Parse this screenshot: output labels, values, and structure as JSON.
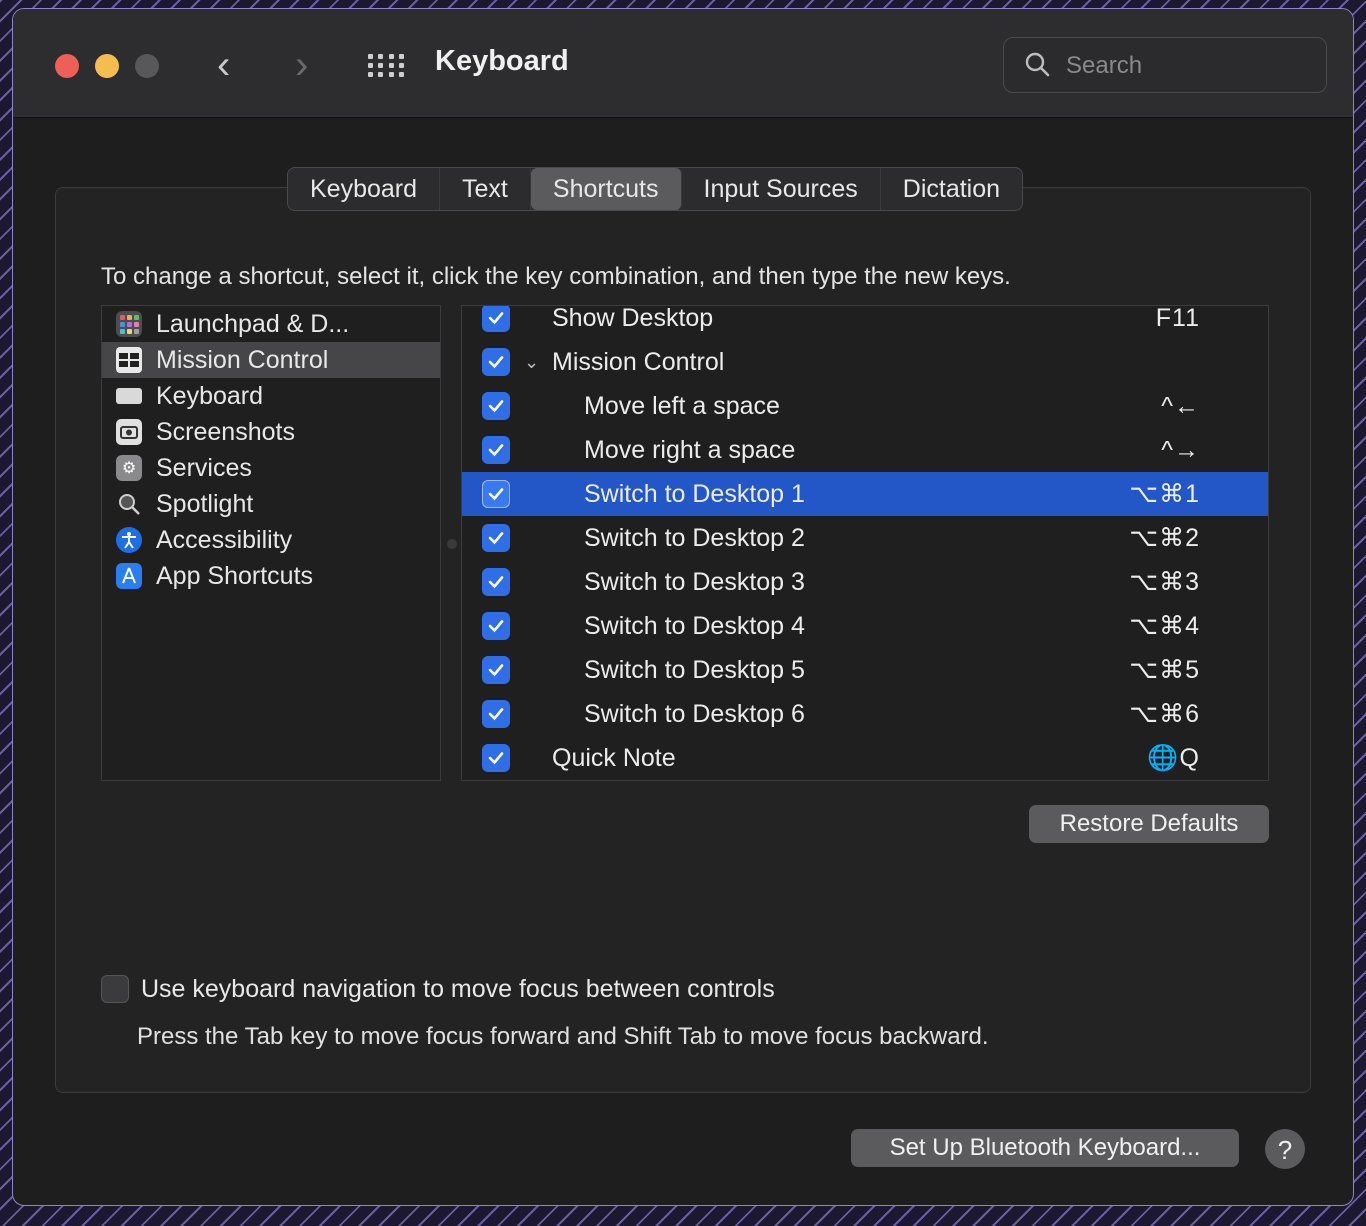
{
  "window": {
    "title": "Keyboard",
    "search_placeholder": "Search"
  },
  "tabs": [
    {
      "label": "Keyboard",
      "active": false
    },
    {
      "label": "Text",
      "active": false
    },
    {
      "label": "Shortcuts",
      "active": true
    },
    {
      "label": "Input Sources",
      "active": false
    },
    {
      "label": "Dictation",
      "active": false
    }
  ],
  "hint": "To change a shortcut, select it, click the key combination, and then type the new keys.",
  "categories": [
    {
      "label": "Launchpad & D...",
      "icon": "launchpad-icon",
      "selected": false
    },
    {
      "label": "Mission Control",
      "icon": "mission-control-icon",
      "selected": true
    },
    {
      "label": "Keyboard",
      "icon": "keyboard-icon",
      "selected": false
    },
    {
      "label": "Screenshots",
      "icon": "screenshots-icon",
      "selected": false
    },
    {
      "label": "Services",
      "icon": "services-gear-icon",
      "selected": false
    },
    {
      "label": "Spotlight",
      "icon": "spotlight-magnifier-icon",
      "selected": false
    },
    {
      "label": "Accessibility",
      "icon": "accessibility-icon",
      "selected": false
    },
    {
      "label": "App Shortcuts",
      "icon": "app-shortcuts-icon",
      "selected": false
    }
  ],
  "shortcuts": [
    {
      "label": "Show Desktop",
      "key": "F11",
      "checked": true,
      "indent": 1,
      "selected": false
    },
    {
      "label": "Mission Control",
      "key": "",
      "checked": true,
      "indent": 1,
      "selected": false,
      "expanded": true
    },
    {
      "label": "Move left a space",
      "key": "^←",
      "checked": true,
      "indent": 2,
      "selected": false
    },
    {
      "label": "Move right a space",
      "key": "^→",
      "checked": true,
      "indent": 2,
      "selected": false
    },
    {
      "label": "Switch to Desktop 1",
      "key": "⌥⌘1",
      "checked": true,
      "indent": 2,
      "selected": true
    },
    {
      "label": "Switch to Desktop 2",
      "key": "⌥⌘2",
      "checked": true,
      "indent": 2,
      "selected": false
    },
    {
      "label": "Switch to Desktop 3",
      "key": "⌥⌘3",
      "checked": true,
      "indent": 2,
      "selected": false
    },
    {
      "label": "Switch to Desktop 4",
      "key": "⌥⌘4",
      "checked": true,
      "indent": 2,
      "selected": false
    },
    {
      "label": "Switch to Desktop 5",
      "key": "⌥⌘5",
      "checked": true,
      "indent": 2,
      "selected": false
    },
    {
      "label": "Switch to Desktop 6",
      "key": "⌥⌘6",
      "checked": true,
      "indent": 2,
      "selected": false
    },
    {
      "label": "Quick Note",
      "key": "🌐Q",
      "checked": true,
      "indent": 1,
      "selected": false
    }
  ],
  "restore_defaults": "Restore Defaults",
  "keyboard_navigation": {
    "label": "Use keyboard navigation to move focus between controls",
    "checked": false,
    "sub": "Press the Tab key to move focus forward and Shift Tab to move focus backward."
  },
  "bluetooth_button": "Set Up Bluetooth Keyboard...",
  "help_button": "?",
  "colors": {
    "accent": "#2f6ee6",
    "selection": "#2356c7",
    "close": "#ee5f57",
    "minimize": "#f4bd4f"
  }
}
